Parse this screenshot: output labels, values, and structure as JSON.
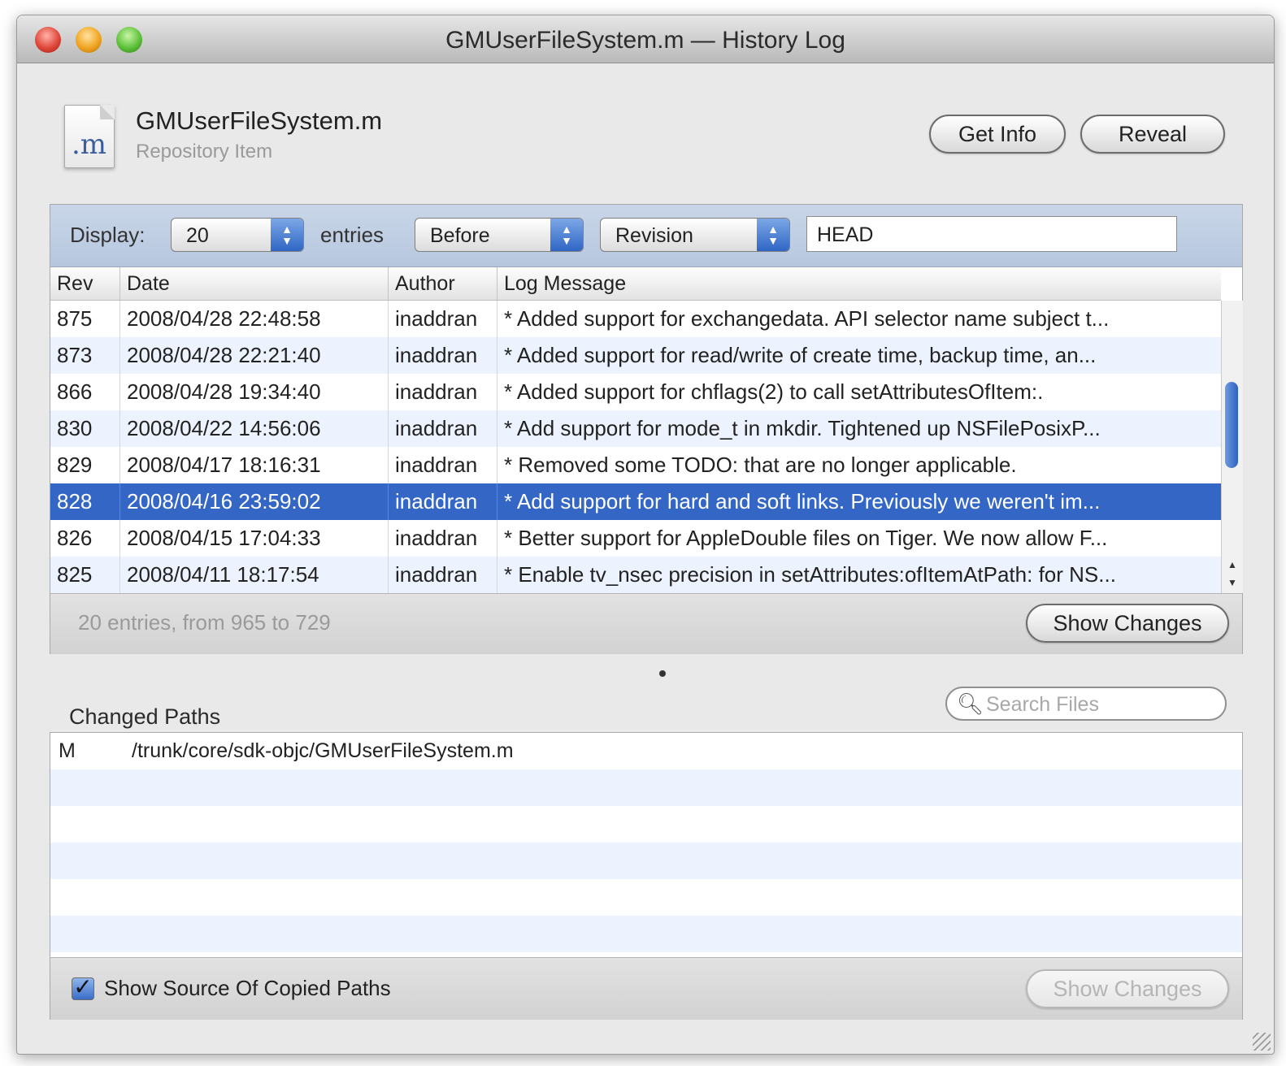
{
  "window": {
    "title": "GMUserFileSystem.m — History Log"
  },
  "item": {
    "icon_text": ".m",
    "name": "GMUserFileSystem.m",
    "kind": "Repository Item"
  },
  "header_buttons": {
    "get_info": "Get Info",
    "reveal": "Reveal"
  },
  "filter": {
    "display_label": "Display:",
    "count_value": "20",
    "entries_label": "entries",
    "relation_value": "Before",
    "type_value": "Revision",
    "revision_value": "HEAD"
  },
  "log_table": {
    "columns": [
      "Rev",
      "Date",
      "Author",
      "Log Message"
    ],
    "rows": [
      {
        "rev": "875",
        "date": "2008/04/28 22:48:58",
        "author": "inaddran",
        "message": "* Added support for exchangedata. API selector name subject t..."
      },
      {
        "rev": "873",
        "date": "2008/04/28 22:21:40",
        "author": "inaddran",
        "message": "* Added support for read/write of create time, backup time, an..."
      },
      {
        "rev": "866",
        "date": "2008/04/28 19:34:40",
        "author": "inaddran",
        "message": "* Added support for chflags(2) to call setAttributesOfItem:."
      },
      {
        "rev": "830",
        "date": "2008/04/22 14:56:06",
        "author": "inaddran",
        "message": "* Add support for mode_t in mkdir. Tightened up NSFilePosixP..."
      },
      {
        "rev": "829",
        "date": "2008/04/17 18:16:31",
        "author": "inaddran",
        "message": "* Removed some TODO: that are no longer applicable."
      },
      {
        "rev": "828",
        "date": "2008/04/16 23:59:02",
        "author": "inaddran",
        "message": "* Add support for hard and soft links. Previously we weren't im..."
      },
      {
        "rev": "826",
        "date": "2008/04/15 17:04:33",
        "author": "inaddran",
        "message": "* Better support for AppleDouble files on Tiger. We now allow F..."
      },
      {
        "rev": "825",
        "date": "2008/04/11 18:17:54",
        "author": "inaddran",
        "message": "* Enable tv_nsec precision in setAttributes:ofItemAtPath: for NS..."
      }
    ],
    "status": "20 entries, from 965 to 729",
    "show_changes": "Show Changes"
  },
  "changed_paths": {
    "label": "Changed Paths",
    "search_placeholder": "Search Files",
    "rows": [
      {
        "action": "M",
        "path": "/trunk/core/sdk-objc/GMUserFileSystem.m"
      }
    ],
    "show_source_label": "Show Source Of Copied Paths",
    "show_source_checked": true,
    "show_changes": "Show Changes"
  },
  "colors": {
    "selection": "#3466c6",
    "stripe": "#edf3fe",
    "filter_bar": "#c1d0e5"
  }
}
